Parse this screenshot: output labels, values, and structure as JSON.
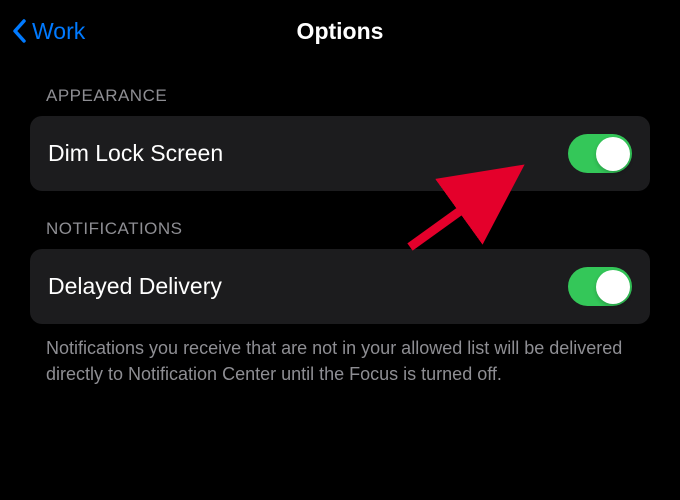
{
  "nav": {
    "back_label": "Work",
    "title": "Options"
  },
  "sections": {
    "appearance": {
      "header": "APPEARANCE",
      "dim_lock_screen": {
        "label": "Dim Lock Screen",
        "enabled": true
      }
    },
    "notifications": {
      "header": "NOTIFICATIONS",
      "delayed_delivery": {
        "label": "Delayed Delivery",
        "enabled": true
      },
      "footer": "Notifications you receive that are not in your allowed list will be delivered directly to Notification Center until the Focus is turned off."
    }
  },
  "colors": {
    "accent": "#007aff",
    "toggle_on": "#34c759",
    "cell_bg": "#1c1c1e",
    "secondary_text": "#8e8e93",
    "arrow": "#e4002b"
  },
  "annotation": {
    "arrow_points_to": "dim-lock-screen-toggle"
  }
}
